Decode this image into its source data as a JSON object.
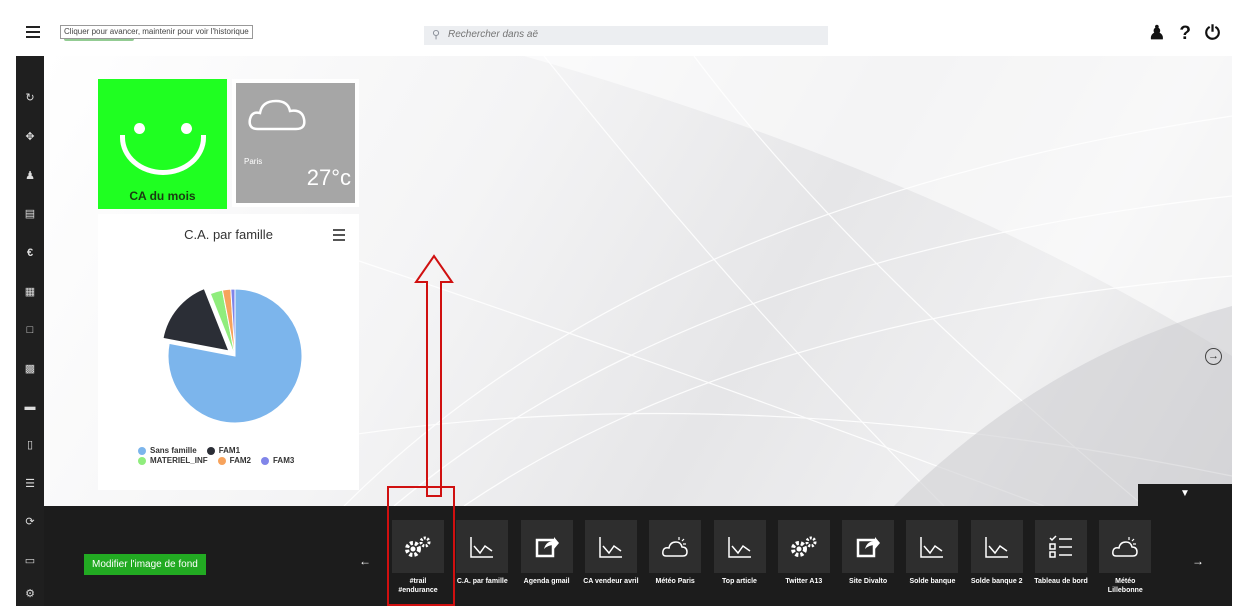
{
  "topbar": {
    "history_hint": "Cliquer pour avancer, maintenir pour voir l'historique",
    "search_placeholder": "Rechercher dans aë",
    "help_icon": "?",
    "power_icon": "⏻",
    "user_icon": "♟"
  },
  "sidebar": {
    "items": [
      "sync-icon",
      "expand-icon",
      "contacts-icon",
      "documents-icon",
      "euro-icon",
      "calendar-icon",
      "folder-icon",
      "inbox-icon",
      "card-icon",
      "sheet-icon",
      "list-icon",
      "refresh-icon",
      "open-folder-icon",
      "settings-icon"
    ]
  },
  "tiles": {
    "smiley_label": "CA du mois",
    "weather_city": "Paris",
    "weather_temp": "27°c",
    "colors": {
      "smiley_bg": "#1fff21",
      "weather_bg": "#a6a6a6"
    }
  },
  "chart_data": {
    "type": "pie",
    "title": "C.A. par famille",
    "categories": [
      "Sans famille",
      "FAM1",
      "MATERIEL_INF",
      "FAM2",
      "FAM3"
    ],
    "values": [
      78,
      16,
      3,
      2,
      1
    ],
    "colors": [
      "#7cb5ec",
      "#2b2e36",
      "#90ed7d",
      "#f7a35c",
      "#8085e9"
    ],
    "exploded": "FAM1",
    "legend_position": "bottom"
  },
  "dock": {
    "background_button": "Modifier l'image de fond",
    "prev": "←",
    "next": "→",
    "toggle": "▼",
    "items": [
      {
        "label": "#trail #endurance",
        "icon": "gears-icon"
      },
      {
        "label": "C.A. par famille",
        "icon": "line-chart-icon"
      },
      {
        "label": "Agenda gmail",
        "icon": "share-icon"
      },
      {
        "label": "CA vendeur avril",
        "icon": "line-chart-icon"
      },
      {
        "label": "Météo Paris",
        "icon": "weather-icon"
      },
      {
        "label": "Top article",
        "icon": "line-chart-icon"
      },
      {
        "label": "Twitter A13",
        "icon": "gears-icon"
      },
      {
        "label": "Site Divalto",
        "icon": "share-icon"
      },
      {
        "label": "Solde banque",
        "icon": "line-chart-icon"
      },
      {
        "label": "Solde banque 2",
        "icon": "line-chart-icon"
      },
      {
        "label": "Tableau de bord",
        "icon": "checklist-icon"
      },
      {
        "label": "Météo Lillebonne",
        "icon": "weather-icon"
      }
    ]
  },
  "right_nav": "→"
}
